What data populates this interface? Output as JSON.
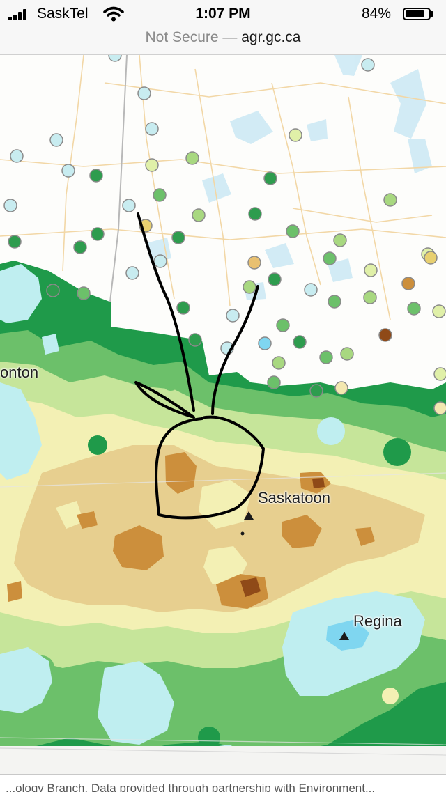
{
  "status_bar": {
    "carrier": "SaskTel",
    "time": "1:07 PM",
    "battery_percent": "84%",
    "battery_level": 0.84
  },
  "browser": {
    "security_label": "Not Secure —",
    "domain": "agr.gc.ca"
  },
  "map": {
    "cities": [
      {
        "name": "onton"
      },
      {
        "name": "Saskatoon"
      },
      {
        "name": "Regina"
      }
    ],
    "colors": {
      "water": "#bfeef0",
      "wet_dark": "#1f9a4a",
      "wet_mid": "#6cc06a",
      "wet_light": "#c6e59a",
      "normal": "#f3f0b4",
      "dry_light": "#e7cf8f",
      "dry_mid": "#cc8f3c",
      "dry_dark": "#8f4a18",
      "roads": "#f2d7a6",
      "annotation_ink": "#000000"
    }
  },
  "footer": {
    "credit": "...ology Branch. Data provided through partnership with Environment..."
  }
}
